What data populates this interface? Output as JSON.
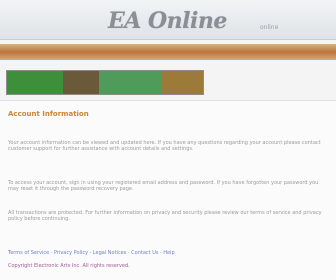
{
  "header": {
    "logo": "EA Online",
    "logo_sub": "online"
  },
  "banner": {
    "segments": [
      {
        "color": "#3d8f3a",
        "flex": 2
      },
      {
        "color": "#6b5a3a",
        "flex": 1.3
      },
      {
        "color": "#4f9c5a",
        "flex": 2.2
      },
      {
        "color": "#9c7b3a",
        "flex": 1.5
      }
    ]
  },
  "section": {
    "title": "Account Information"
  },
  "paragraphs": [
    {
      "text": "Your account information can be viewed and updated here. If you have any questions regarding your account please contact customer support for further assistance with account details and settings."
    },
    {
      "text": "To access your account, sign in using your registered email address and password. If you have forgotten your password you may reset it through the password recovery page."
    },
    {
      "text": "All transactions are protected. For further information on privacy and security please review our terms of service and privacy policy before continuing."
    }
  ],
  "footer": {
    "line1": "Terms of Service · Privacy Policy · Legal Notices · Contact Us · Help",
    "line2": "Copyright Electronic Arts Inc. All rights reserved."
  }
}
